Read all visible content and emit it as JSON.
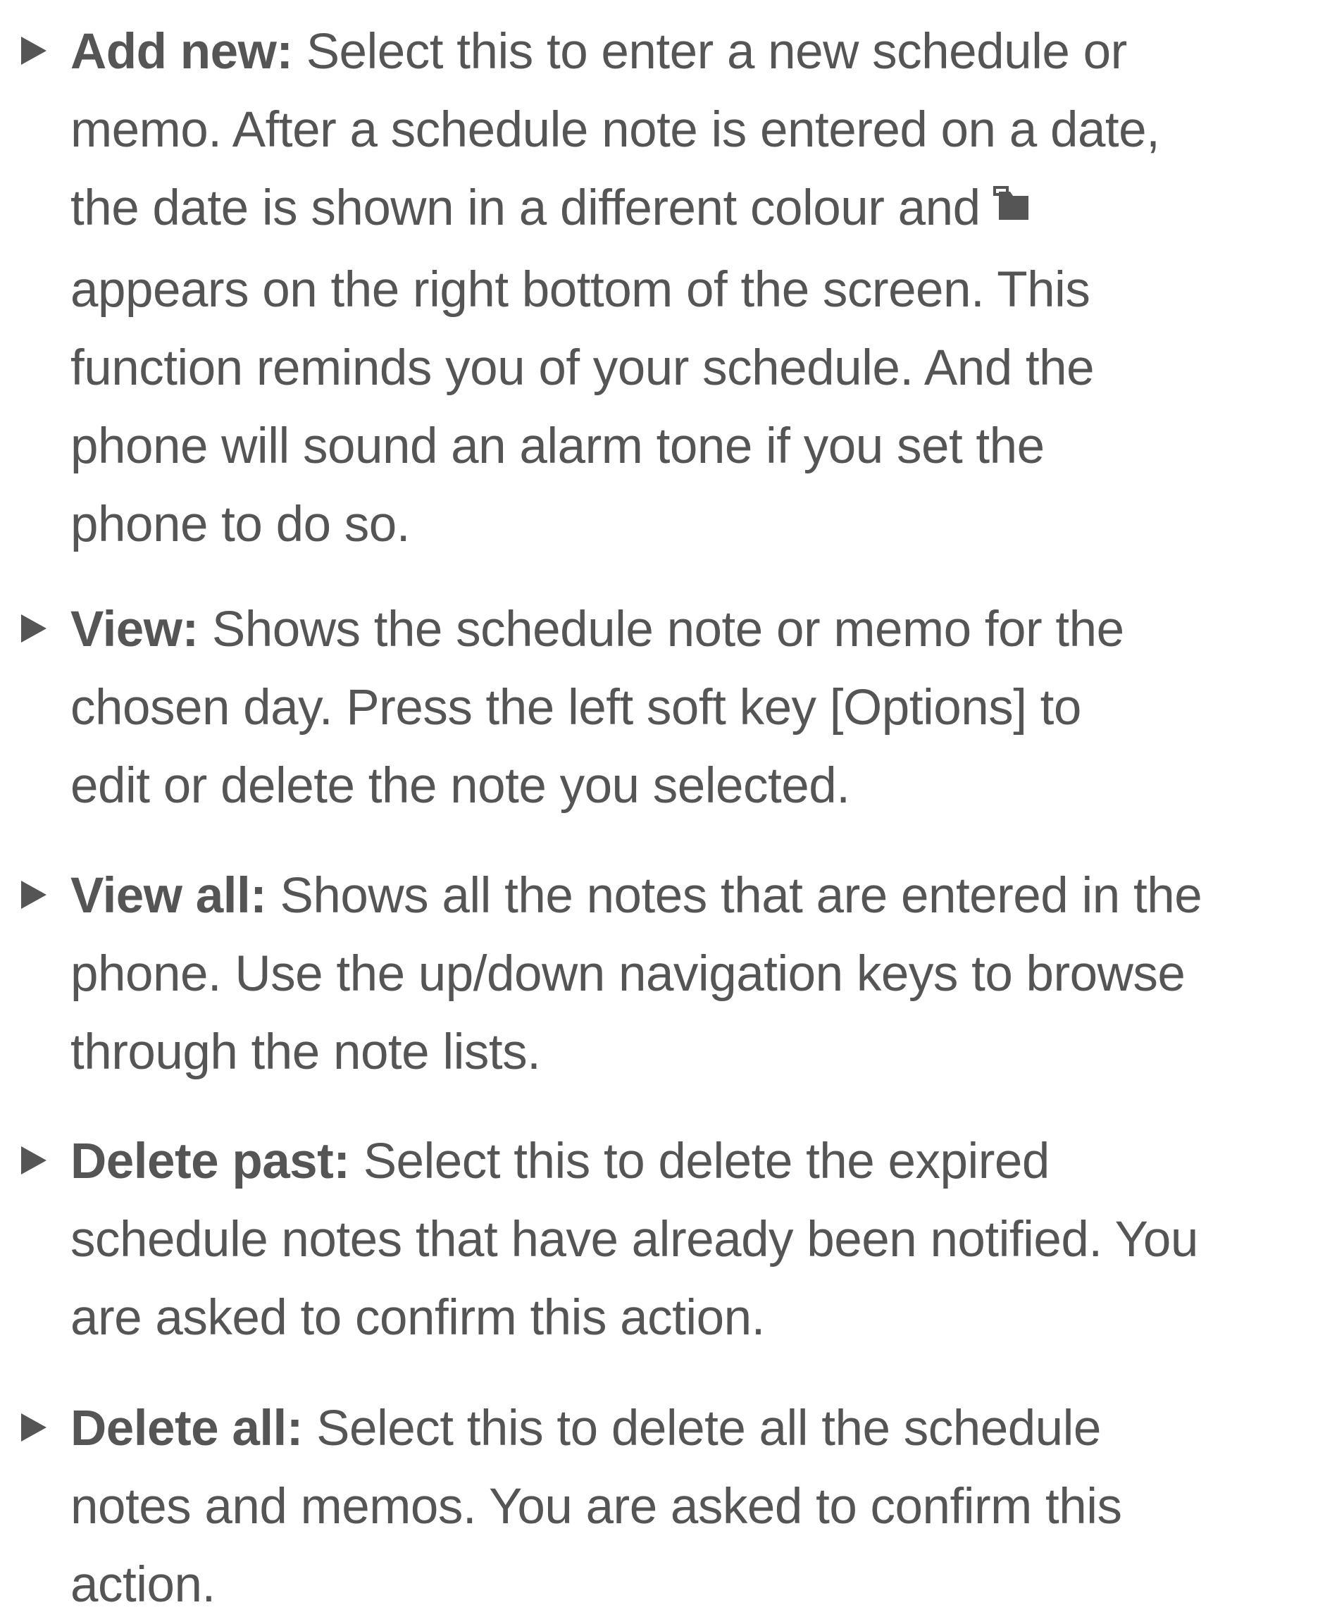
{
  "items": [
    {
      "term": "Add new:",
      "lines": [
        " Select this to enter a new schedule or",
        "memo. After a schedule note is entered on a date,",
        "the date is shown in a different colour and",
        "appears on the right bottom of the screen. This",
        "function reminds you of your schedule. And the",
        "phone will sound an alarm tone if you set the",
        "phone to do so."
      ],
      "icon": "schedule-note-icon"
    },
    {
      "term": "View:",
      "lines": [
        " Shows the schedule note or memo for the",
        "chosen day. Press the left soft key [Options] to",
        "edit or delete the note you selected."
      ]
    },
    {
      "term": "View all:",
      "lines": [
        " Shows all the notes that are entered in the",
        "phone. Use the up/down navigation keys to browse",
        "through the note lists."
      ]
    },
    {
      "term": "Delete past:",
      "lines": [
        " Select this to delete the expired",
        "schedule notes that have already been notified. You",
        "are asked to confirm this action."
      ]
    },
    {
      "term": "Delete all:",
      "lines": [
        " Select this to delete all the schedule",
        "notes and memos. You are asked to confirm this",
        "action."
      ]
    }
  ],
  "colors": {
    "text": "#555555",
    "background": "#ffffff"
  }
}
